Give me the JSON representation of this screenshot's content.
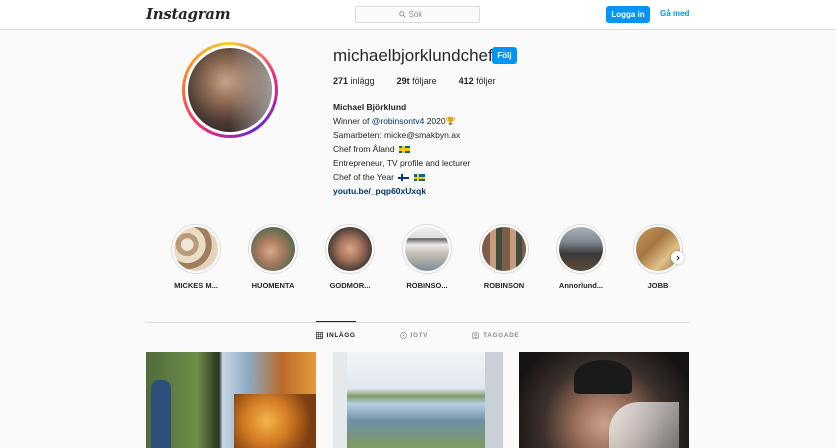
{
  "header": {
    "logo_text": "Instagram",
    "search": {
      "placeholder": "Sök",
      "icon": "search-icon"
    },
    "login_label": "Logga in",
    "signup_label": "Gå med"
  },
  "profile": {
    "username": "michaelbjorklundchef",
    "follow_label": "Följ",
    "stats": [
      {
        "value": "271",
        "label": "inlägg"
      },
      {
        "value": "29t",
        "label": "följare"
      },
      {
        "value": "412",
        "label": "följer"
      }
    ],
    "bio": {
      "full_name": "Michael Björklund",
      "line1_prefix": "Winner of ",
      "line1_mention": "@robinsontv4",
      "line1_suffix": " 2020",
      "line2": "Samarbeten: micke@smakbyn.ax",
      "line3": "Chef from Åland",
      "line4": "Entrepreneur, TV profile and lecturer",
      "line5": "Chef of the Year",
      "link": "youtu.be/_pqp60xUxqk"
    }
  },
  "highlights": [
    {
      "label": "MICKES M...",
      "color": "#c9b49a"
    },
    {
      "label": "HUOMENTA",
      "color": "#9b7a66"
    },
    {
      "label": "GODMOR...",
      "color": "#8a6b5a"
    },
    {
      "label": "ROBINSO...",
      "color": "#d6d9dc"
    },
    {
      "label": "ROBINSON",
      "color": "#6b5a4a"
    },
    {
      "label": "Annorlund...",
      "color": "#5e6a72"
    },
    {
      "label": "JOBB",
      "color": "#a88a5c"
    }
  ],
  "tabs": [
    {
      "label": "INLÄGG",
      "icon": "grid-icon",
      "active": true
    },
    {
      "label": "IGTV",
      "icon": "igtv-icon",
      "active": false
    },
    {
      "label": "TAGGADE",
      "icon": "tagged-icon",
      "active": false
    }
  ]
}
